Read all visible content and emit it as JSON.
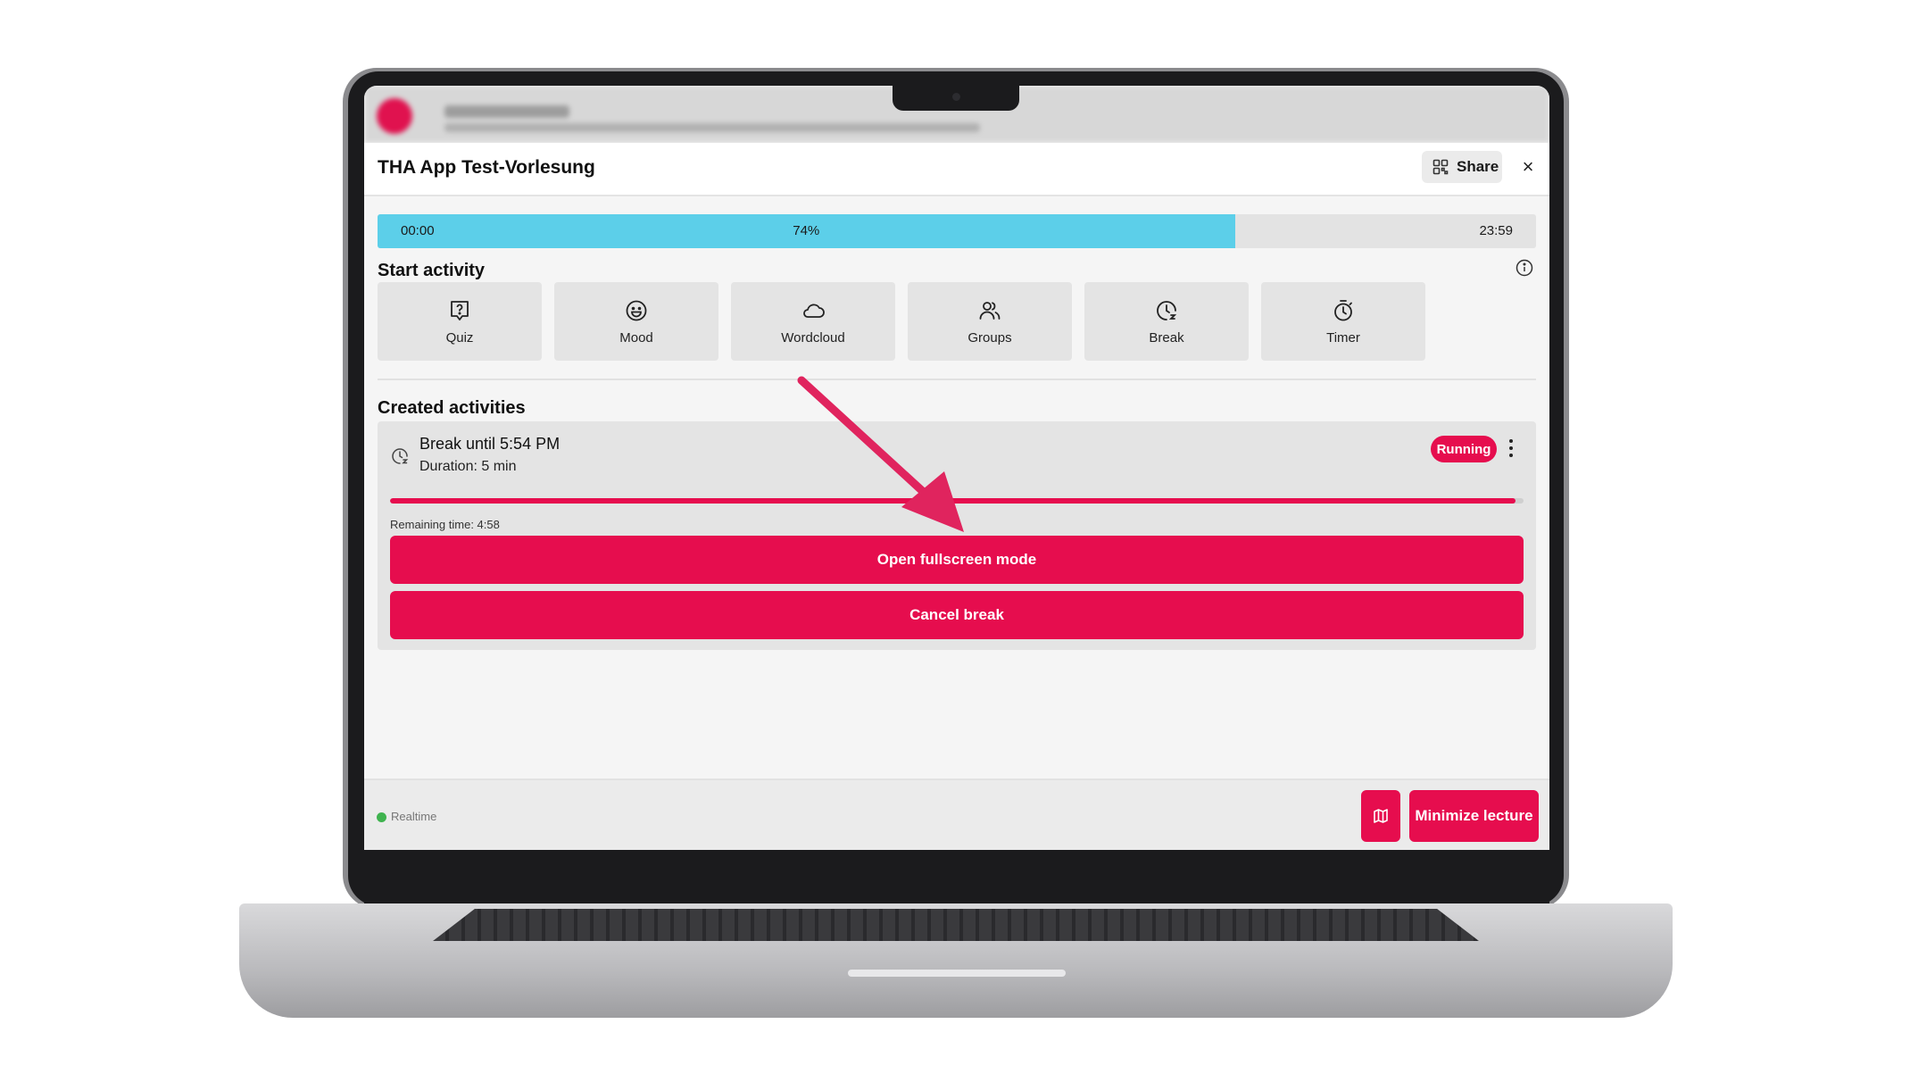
{
  "modal": {
    "title": "THA App Test-Vorlesung",
    "share_label": "Share",
    "close_symbol": "×"
  },
  "lecture_progress": {
    "start_time": "00:00",
    "percent_label": "74%",
    "percent": 74,
    "end_time": "23:59"
  },
  "start_activity": {
    "title": "Start activity",
    "items": [
      {
        "label": "Quiz",
        "icon": "quiz-icon"
      },
      {
        "label": "Mood",
        "icon": "smiley-icon"
      },
      {
        "label": "Wordcloud",
        "icon": "cloud-icon"
      },
      {
        "label": "Groups",
        "icon": "users-icon"
      },
      {
        "label": "Break",
        "icon": "clock-icon"
      },
      {
        "label": "Timer",
        "icon": "stopwatch-icon"
      }
    ]
  },
  "created_activities": {
    "title": "Created activities",
    "card": {
      "title": "Break until 5:54 PM",
      "subtitle": "Duration: 5 min",
      "status": "Running",
      "remaining_label": "Remaining time: 4:58",
      "remaining_fraction": 0.993,
      "primary_button": "Open fullscreen mode",
      "secondary_button": "Cancel break"
    }
  },
  "footer": {
    "realtime_label": "Realtime",
    "minimize_label": "Minimize lecture"
  },
  "colors": {
    "accent": "#e60d4e",
    "progress": "#5ccfe9",
    "status_ok": "#3fb34f"
  }
}
